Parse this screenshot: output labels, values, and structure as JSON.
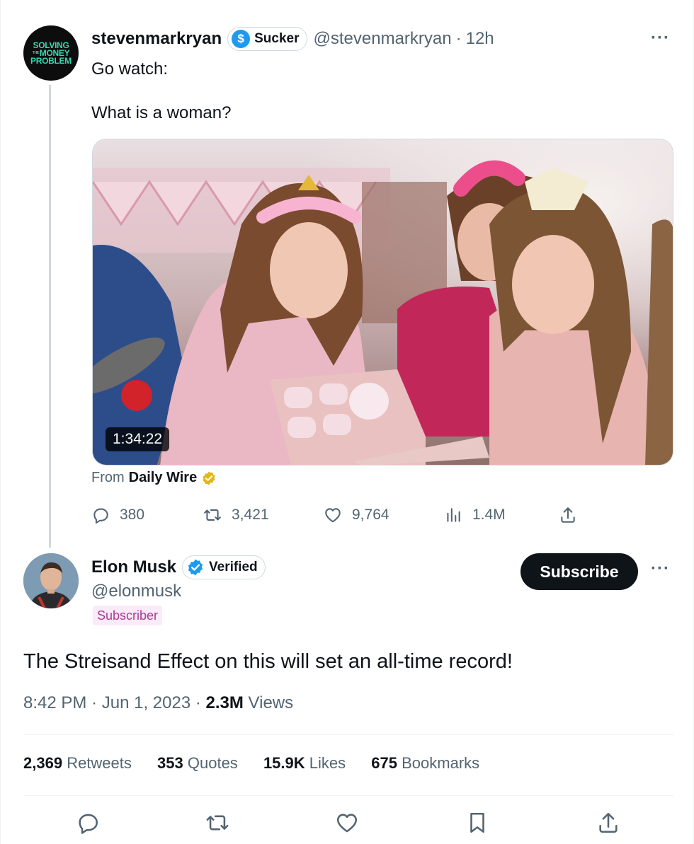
{
  "parent_tweet": {
    "display_name": "stevenmarkryan",
    "badge_label": "Sucker",
    "handle": "@stevenmarkryan",
    "time": "12h",
    "avatar_text": [
      "SOLVING",
      "THE",
      "MONEY",
      "PROBLEM"
    ],
    "text_line1": "Go watch:",
    "text_line2": "What is a woman?",
    "video_duration": "1:34:22",
    "from_label": "From",
    "from_source": "Daily Wire",
    "replies": "380",
    "retweets": "3,421",
    "likes": "9,764",
    "views": "1.4M"
  },
  "main_tweet": {
    "display_name": "Elon Musk",
    "badge_label": "Verified",
    "handle": "@elonmusk",
    "subscriber_label": "Subscriber",
    "subscribe_button": "Subscribe",
    "text": "The Streisand Effect on this will set an all-time record!",
    "time": "8:42 PM",
    "date": "Jun 1, 2023",
    "views_count": "2.3M",
    "views_label": "Views",
    "stats": [
      {
        "count": "2,369",
        "label": "Retweets"
      },
      {
        "count": "353",
        "label": "Quotes"
      },
      {
        "count": "15.9K",
        "label": "Likes"
      },
      {
        "count": "675",
        "label": "Bookmarks"
      }
    ]
  },
  "colors": {
    "accent": "#1d9bf0",
    "text_secondary": "#536471",
    "subscriber_bg": "#fbeaf7",
    "subscriber_text": "#a73b94",
    "gold_check": "#e2b719"
  },
  "icons": [
    "dollar-icon",
    "verified-check-icon",
    "gold-check-icon",
    "reply-icon",
    "retweet-icon",
    "like-icon",
    "views-icon",
    "share-icon",
    "bookmark-icon",
    "more-icon"
  ]
}
